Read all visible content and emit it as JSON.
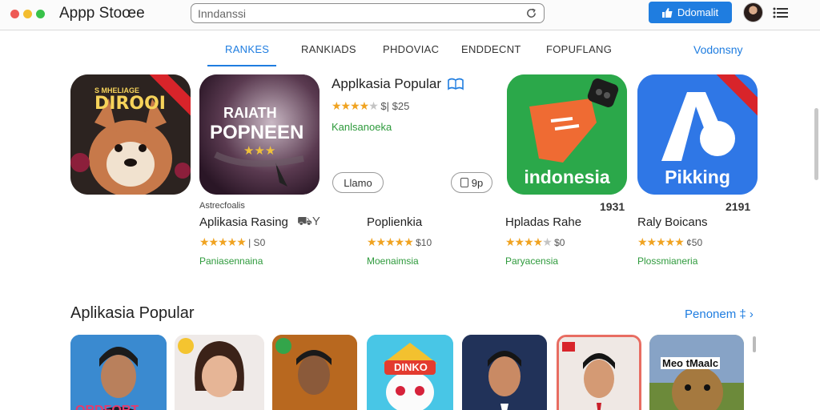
{
  "window": {
    "title": "Appp Stoœe"
  },
  "search": {
    "placeholder": "Inndanssi"
  },
  "header": {
    "download_label": "Ddomalit"
  },
  "tabs": [
    {
      "label": "RANKES",
      "active": true
    },
    {
      "label": "RANKIADS",
      "active": false
    },
    {
      "label": "PHDOVIAC",
      "active": false
    },
    {
      "label": "ENDDECNT",
      "active": false
    },
    {
      "label": "FOPUFLANG",
      "active": false
    }
  ],
  "tabs_link": "Vodonsny",
  "featured": {
    "tile1_text": [
      "S MHELIAGE",
      "DIROOI"
    ],
    "tile2_text": [
      "RAIATH",
      "POPNEEN"
    ],
    "title": "Applkasia Popular",
    "rating_stars": 4,
    "rating_text": "$| $25",
    "category": "Kanlsanoeka",
    "button_left": "Llamo",
    "button_right": "9p"
  },
  "apps": [
    {
      "caption": "Astrecfoalis",
      "name": "Aplikasia Rasing",
      "stars": 5,
      "price": "| S0",
      "category": "Paniasennaina",
      "count": ""
    },
    {
      "caption": "",
      "name": "Poplienkia",
      "stars": 5,
      "price": "$10",
      "category": "Moenaimsia",
      "count": ""
    },
    {
      "caption": "",
      "name": "Hpladas Rahe",
      "stars": 4,
      "price": "$0",
      "category": "Paryacensia",
      "count": "1931",
      "icon_text": "indonesia"
    },
    {
      "caption": "",
      "name": "Raly Boicans",
      "stars": 5,
      "price": "¢50",
      "category": "Plossmianeria",
      "count": "2191",
      "icon_text": "Pikking"
    }
  ],
  "section": {
    "title": "Aplikasia Popular",
    "link": "Penonem ‡ ›"
  },
  "popular_tiles": [
    {
      "label": "ORDFORT"
    },
    {
      "label": ""
    },
    {
      "label": ""
    },
    {
      "label": "DINKO"
    },
    {
      "label": ""
    },
    {
      "label": ""
    },
    {
      "label": "Meo tMaalc"
    }
  ],
  "colors": {
    "accent": "#1f7de0",
    "star": "#f0a321",
    "category_green": "#2e9a3c"
  },
  "icons": [
    "refresh-icon",
    "download-icon",
    "avatar",
    "list-menu-icon",
    "book-icon"
  ]
}
